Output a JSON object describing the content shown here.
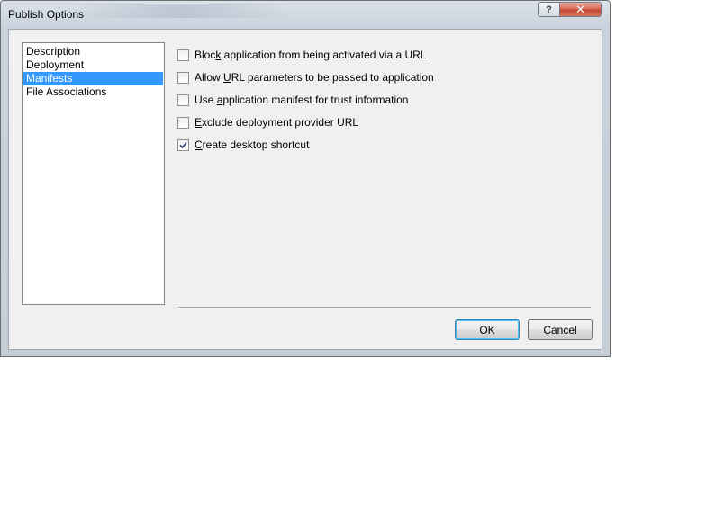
{
  "window": {
    "title": "Publish Options",
    "help_glyph": "?",
    "close_glyph": "✕"
  },
  "sidebar": {
    "items": [
      {
        "label": "Description",
        "selected": false
      },
      {
        "label": "Deployment",
        "selected": false
      },
      {
        "label": "Manifests",
        "selected": true
      },
      {
        "label": "File Associations",
        "selected": false
      }
    ]
  },
  "options": [
    {
      "pre": "Bloc",
      "accel": "k",
      "post": " application from being activated via a URL",
      "checked": false
    },
    {
      "pre": "Allow ",
      "accel": "U",
      "post": "RL parameters to be passed to application",
      "checked": false
    },
    {
      "pre": "Use ",
      "accel": "a",
      "post": "pplication manifest for trust information",
      "checked": false
    },
    {
      "pre": "",
      "accel": "E",
      "post": "xclude deployment provider URL",
      "checked": false
    },
    {
      "pre": "",
      "accel": "C",
      "post": "reate desktop shortcut",
      "checked": true
    }
  ],
  "buttons": {
    "ok_label": "OK",
    "cancel_label": "Cancel"
  }
}
